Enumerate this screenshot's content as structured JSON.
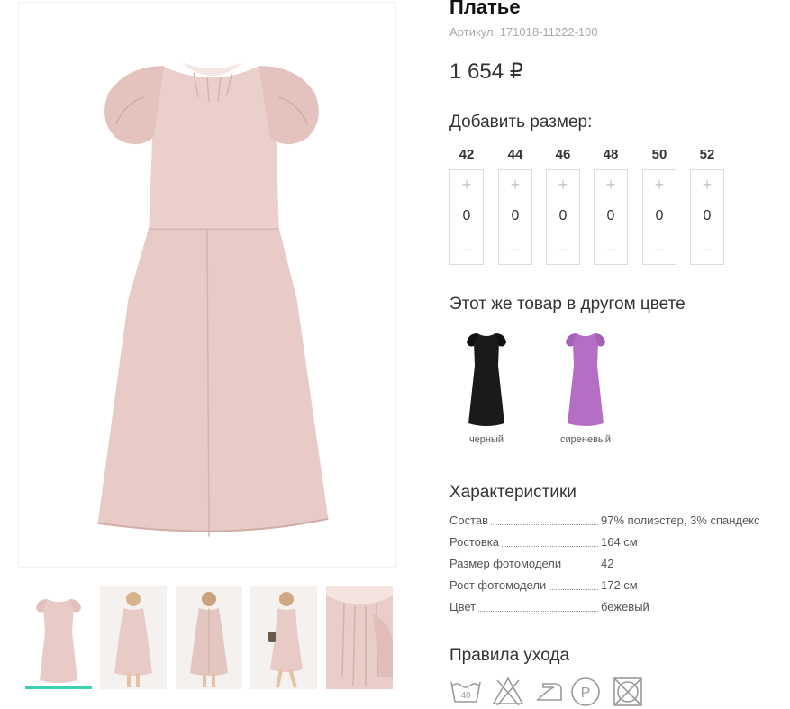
{
  "product": {
    "title": "Платье",
    "sku": "Артикул: 171018-11222-100",
    "price": "1 654 ₽"
  },
  "colors": {
    "dress_main": "#e8cbc6",
    "dress_shadow": "#d9b6b0",
    "accent": "#3ccfb2"
  },
  "add_size": {
    "heading": "Добавить размер:",
    "plus": "+",
    "minus": "–",
    "sizes": [
      {
        "label": "42",
        "qty": "0"
      },
      {
        "label": "44",
        "qty": "0"
      },
      {
        "label": "46",
        "qty": "0"
      },
      {
        "label": "48",
        "qty": "0"
      },
      {
        "label": "50",
        "qty": "0"
      },
      {
        "label": "52",
        "qty": "0"
      }
    ]
  },
  "other_colors": {
    "heading": "Этот же товар в другом цвете",
    "items": [
      {
        "name": "черный",
        "color": "#1a1a1a"
      },
      {
        "name": "сиреневый",
        "color": "#b46ec4"
      }
    ]
  },
  "characteristics": {
    "heading": "Характеристики",
    "rows": [
      {
        "key": "Состав",
        "value": "97% полиэстер, 3% спандекс"
      },
      {
        "key": "Ростовка",
        "value": "164 см"
      },
      {
        "key": "Размер фотомодели",
        "value": "42"
      },
      {
        "key": "Рост фотомодели",
        "value": "172 см"
      },
      {
        "key": "Цвет",
        "value": "бежевый"
      }
    ]
  },
  "care": {
    "heading": "Правила ухода",
    "wash_temp": "40",
    "dryclean_letter": "P",
    "icons": [
      "wash-40-icon",
      "no-bleach-icon",
      "iron-icon",
      "dry-clean-p-icon",
      "no-tumble-dry-icon"
    ]
  },
  "gallery": {
    "active_index": 0,
    "thumbs": [
      "thumb-front",
      "thumb-model-front",
      "thumb-model-back",
      "thumb-model-side",
      "thumb-detail"
    ]
  }
}
